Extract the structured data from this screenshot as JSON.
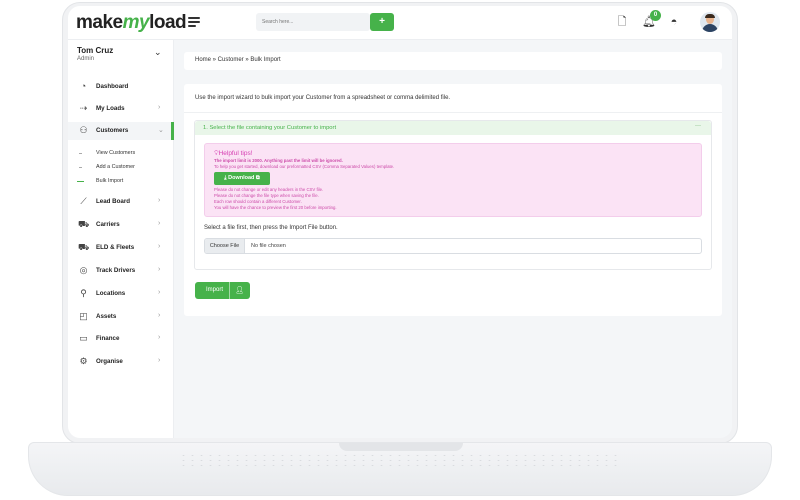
{
  "app": {
    "logo_make": "make",
    "logo_my": "my",
    "logo_load": "load"
  },
  "search": {
    "placeholder": "Search here...",
    "add_label": "+"
  },
  "notifications": {
    "count": "0"
  },
  "user": {
    "name": "Tom Cruz",
    "role": "Admin"
  },
  "sidebar": {
    "items": [
      {
        "label": "Dashboard",
        "icon": "dashboard-icon",
        "chevron": ""
      },
      {
        "label": "My Loads",
        "icon": "truck-icon",
        "chevron": "›"
      },
      {
        "label": "Customers",
        "icon": "users-icon",
        "chevron": "⌄"
      },
      {
        "label": "Lead Board",
        "icon": "chart-icon",
        "chevron": "›"
      },
      {
        "label": "Carriers",
        "icon": "carrier-icon",
        "chevron": "›"
      },
      {
        "label": "ELD & Fleets",
        "icon": "fleet-icon",
        "chevron": "›"
      },
      {
        "label": "Track Drivers",
        "icon": "pin-icon",
        "chevron": "›"
      },
      {
        "label": "Locations",
        "icon": "location-icon",
        "chevron": "›"
      },
      {
        "label": "Assets",
        "icon": "bag-icon",
        "chevron": "›"
      },
      {
        "label": "Finance",
        "icon": "finance-icon",
        "chevron": "›"
      },
      {
        "label": "Organise",
        "icon": "gear-icon",
        "chevron": "›"
      }
    ],
    "sub_items": [
      {
        "label": "View Customers"
      },
      {
        "label": "Add a Customer"
      },
      {
        "label": "Bulk Import"
      }
    ]
  },
  "breadcrumb": "Home » Customer » Bulk Import",
  "main": {
    "intro": "Use the import wizard to bulk import your Customer from a spreadsheet or comma delimited file.",
    "step_title": "1. Select the file containing your Customer to import",
    "tips": {
      "title": "Helpful tips!",
      "line1": "The import limit is 2000. Anything past the limit will be ignored.",
      "line2": "To help you get started, download our preformatted CSV (Comma Separated Values) template.",
      "download_label": "Download",
      "line3": "Please do not change or edit any headers in the CSV file.",
      "line4": "Please do not change the file type when saving the file.",
      "line5": "Each row should contain a different Customer.",
      "line6": "You will have the chance to preview the first 20 before importing."
    },
    "file_instruction": "Select a file first, then press the Import File button.",
    "choose_label": "Choose File",
    "file_status": "No file chosen",
    "import_label": "Import"
  },
  "colors": {
    "accent": "#46b24a",
    "tips_bg": "#fbe3f5",
    "tips_text": "#cc4aa8"
  }
}
